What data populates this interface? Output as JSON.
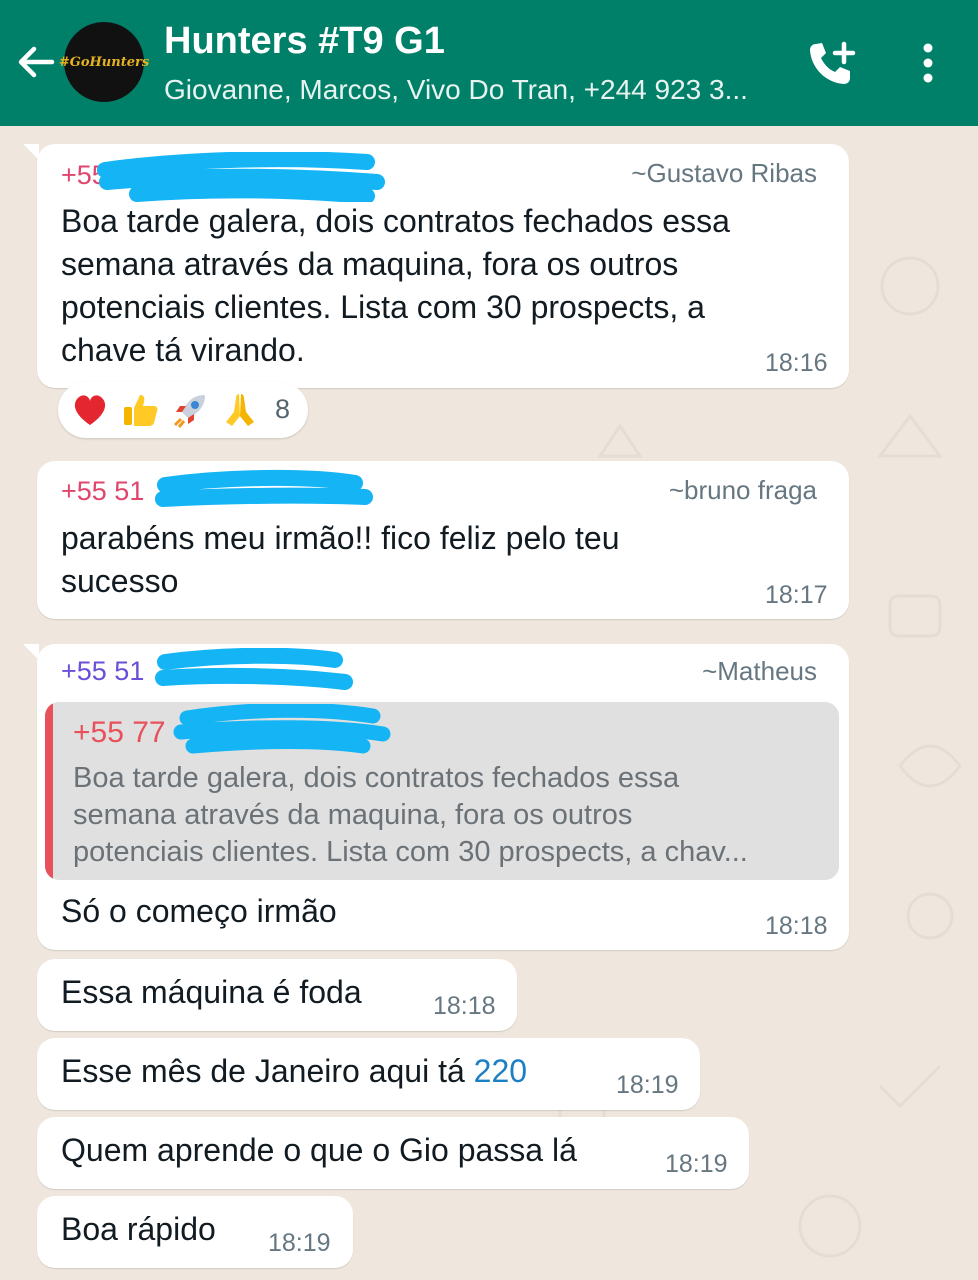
{
  "header": {
    "title": "Hunters #T9 G1",
    "subtitle": "Giovanne, Marcos, Vivo Do Tran, +244 923 3...",
    "avatar_text": "#GoHunters",
    "color": "#008069"
  },
  "icons": {
    "back": "arrow-left-icon",
    "call": "add-call-icon",
    "menu": "more-vertical-icon"
  },
  "messages": [
    {
      "sender_number": "+55",
      "sender_name": "~Gustavo Ribas",
      "sender_color": "#e0456c",
      "lines": [
        "Boa tarde galera, dois contratos fechados essa",
        "semana através da maquina, fora os outros",
        "potenciais clientes.  Lista com 30 prospects, a",
        "chave tá virando."
      ],
      "time": "18:16",
      "reactions": [
        "❤️",
        "👍",
        "🚀",
        "🙏"
      ],
      "reaction_count": "8"
    },
    {
      "sender_number": "+55 51",
      "sender_name": "~bruno fraga",
      "sender_color": "#e0456c",
      "lines": [
        "parabéns meu irmão!! fico feliz pelo teu",
        "sucesso"
      ],
      "time": "18:17"
    },
    {
      "sender_number": "+55 51",
      "sender_name": "~Matheus",
      "sender_color": "#6b4fd8",
      "quote_sender": "+55 77",
      "quote_lines": [
        "Boa tarde galera, dois contratos fechados essa",
        "semana através da maquina, fora os outros",
        "potenciais clientes.  Lista com 30 prospects, a chav..."
      ],
      "text": "Só o começo irmão",
      "time": "18:18"
    },
    {
      "text": "Essa máquina é foda",
      "time": "18:18"
    },
    {
      "text_prefix": "Esse mês de Janeiro aqui tá ",
      "text_link": "220",
      "time": "18:19"
    },
    {
      "text": "Quem aprende o que o Gio passa lá",
      "time": "18:19"
    },
    {
      "text": "Boa rápido",
      "time": "18:19"
    }
  ]
}
